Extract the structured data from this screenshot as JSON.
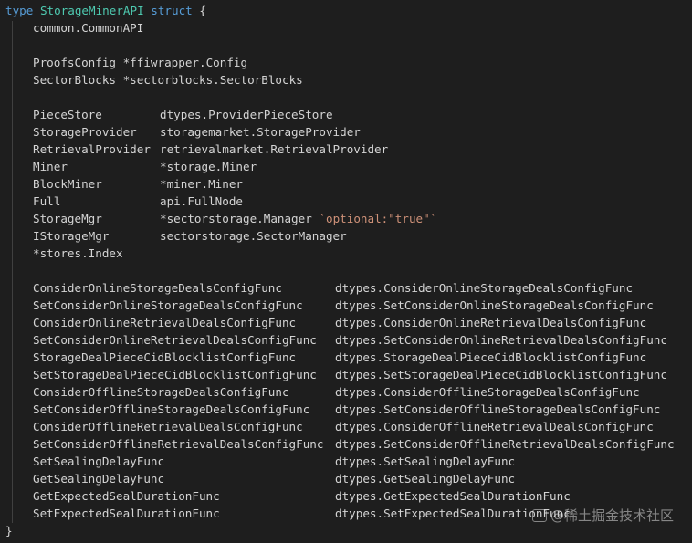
{
  "header": {
    "keyword_type": "type",
    "name": "StorageMinerAPI",
    "keyword_struct": "struct",
    "open_brace": "{"
  },
  "close_brace": "}",
  "embedded": [
    "common.CommonAPI"
  ],
  "group1": [
    {
      "field": "ProofsConfig",
      "type": "*ffiwrapper.Config"
    },
    {
      "field": "SectorBlocks",
      "type": "*sectorblocks.SectorBlocks"
    }
  ],
  "group2": [
    {
      "field": "PieceStore",
      "type": "dtypes.ProviderPieceStore",
      "tag": ""
    },
    {
      "field": "StorageProvider",
      "type": "storagemarket.StorageProvider",
      "tag": ""
    },
    {
      "field": "RetrievalProvider",
      "type": "retrievalmarket.RetrievalProvider",
      "tag": ""
    },
    {
      "field": "Miner",
      "type": "*storage.Miner",
      "tag": ""
    },
    {
      "field": "BlockMiner",
      "type": "*miner.Miner",
      "tag": ""
    },
    {
      "field": "Full",
      "type": "api.FullNode",
      "tag": ""
    },
    {
      "field": "StorageMgr",
      "type": "*sectorstorage.Manager",
      "tag": "`optional:\"true\"`"
    },
    {
      "field": "IStorageMgr",
      "type": "sectorstorage.SectorManager",
      "tag": ""
    }
  ],
  "embedded2": "*stores.Index",
  "group3": [
    {
      "field": "ConsiderOnlineStorageDealsConfigFunc",
      "type": "dtypes.ConsiderOnlineStorageDealsConfigFunc"
    },
    {
      "field": "SetConsiderOnlineStorageDealsConfigFunc",
      "type": "dtypes.SetConsiderOnlineStorageDealsConfigFunc"
    },
    {
      "field": "ConsiderOnlineRetrievalDealsConfigFunc",
      "type": "dtypes.ConsiderOnlineRetrievalDealsConfigFunc"
    },
    {
      "field": "SetConsiderOnlineRetrievalDealsConfigFunc",
      "type": "dtypes.SetConsiderOnlineRetrievalDealsConfigFunc"
    },
    {
      "field": "StorageDealPieceCidBlocklistConfigFunc",
      "type": "dtypes.StorageDealPieceCidBlocklistConfigFunc"
    },
    {
      "field": "SetStorageDealPieceCidBlocklistConfigFunc",
      "type": "dtypes.SetStorageDealPieceCidBlocklistConfigFunc"
    },
    {
      "field": "ConsiderOfflineStorageDealsConfigFunc",
      "type": "dtypes.ConsiderOfflineStorageDealsConfigFunc"
    },
    {
      "field": "SetConsiderOfflineStorageDealsConfigFunc",
      "type": "dtypes.SetConsiderOfflineStorageDealsConfigFunc"
    },
    {
      "field": "ConsiderOfflineRetrievalDealsConfigFunc",
      "type": "dtypes.ConsiderOfflineRetrievalDealsConfigFunc"
    },
    {
      "field": "SetConsiderOfflineRetrievalDealsConfigFunc",
      "type": "dtypes.SetConsiderOfflineRetrievalDealsConfigFunc"
    },
    {
      "field": "SetSealingDelayFunc",
      "type": "dtypes.SetSealingDelayFunc"
    },
    {
      "field": "GetSealingDelayFunc",
      "type": "dtypes.GetSealingDelayFunc"
    },
    {
      "field": "GetExpectedSealDurationFunc",
      "type": "dtypes.GetExpectedSealDurationFunc"
    },
    {
      "field": "SetExpectedSealDurationFunc",
      "type": "dtypes.SetExpectedSealDurationFunc"
    }
  ],
  "watermark": "@稀土掘金技术社区",
  "colors": {
    "background": "#1e1e1e",
    "keyword": "#569cd6",
    "type_name": "#4ec9b0",
    "text": "#d4d4d4",
    "string_tag": "#ce9178"
  }
}
